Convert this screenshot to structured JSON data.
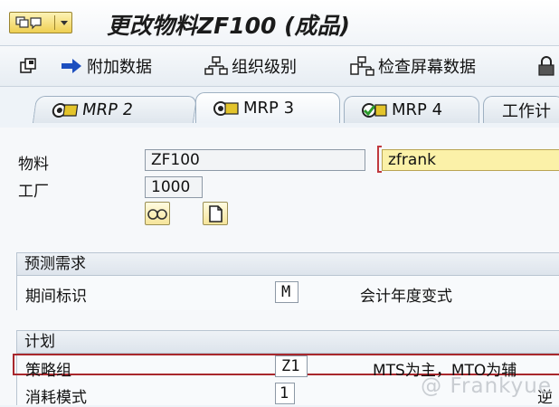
{
  "title": "更改物料ZF100 (成品)",
  "toolbar": {
    "items": [
      {
        "label": "",
        "icon": "copy-icon"
      },
      {
        "label": "附加数据",
        "icon": "arrow-right-icon"
      },
      {
        "label": "组织级别",
        "icon": "org-tree-icon"
      },
      {
        "label": "检查屏幕数据",
        "icon": "check-screen-icon"
      },
      {
        "label": "",
        "icon": "lock-icon"
      }
    ]
  },
  "tabs": [
    {
      "label": "MRP 2",
      "icon": "mrp-icon",
      "active": false
    },
    {
      "label": "MRP 3",
      "icon": "mrp-icon",
      "active": true
    },
    {
      "label": "MRP 4",
      "icon": "mrp-check-icon",
      "active": false
    },
    {
      "label": "工作计",
      "icon": "",
      "active": false
    }
  ],
  "header": {
    "material_label": "物料",
    "material_value": "ZF100",
    "description_value": "zfrank",
    "plant_label": "工厂",
    "plant_value": "1000"
  },
  "forecast": {
    "title": "预测需求",
    "period_label": "期间标识",
    "period_value": "M",
    "fiscal_label": "会计年度变式"
  },
  "planning": {
    "title": "计划",
    "strategy_label": "策略组",
    "strategy_value": "Z1",
    "strategy_desc": "MTS为主，MTO为辅",
    "consumption_label": "消耗模式",
    "consumption_value": "1",
    "consumption_desc": "逆"
  },
  "watermark": "@ Frankyue"
}
